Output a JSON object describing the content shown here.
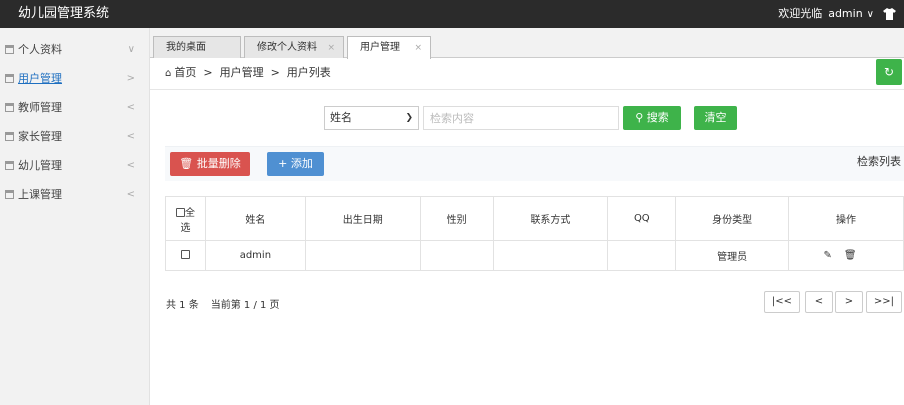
{
  "app": {
    "title": "幼儿园管理系统",
    "welcome": "欢迎光临",
    "username": "admin",
    "caret": "∨"
  },
  "sidebar": {
    "items": [
      {
        "label": "个人资料",
        "arrow": "∨"
      },
      {
        "label": "用户管理",
        "arrow": ">"
      },
      {
        "label": "教师管理",
        "arrow": "<"
      },
      {
        "label": "家长管理",
        "arrow": "<"
      },
      {
        "label": "幼儿管理",
        "arrow": "<"
      },
      {
        "label": "上课管理",
        "arrow": "<"
      }
    ]
  },
  "tabs": [
    {
      "label": "我的桌面"
    },
    {
      "label": "修改个人资料",
      "close": "×"
    },
    {
      "label": "用户管理",
      "close": "×"
    }
  ],
  "breadcrumb": {
    "home": "首页",
    "sep": ">",
    "level1": "用户管理",
    "level2": "用户列表"
  },
  "search": {
    "field": "姓名",
    "placeholder": "检索内容",
    "search_label": "搜索",
    "clear_label": "清空"
  },
  "actions": {
    "batch_delete": "批量删除",
    "add": "添加",
    "right_text": "检索列表"
  },
  "table": {
    "select_all_line1": "全",
    "select_all_line2": "选",
    "headers": [
      "姓名",
      "出生日期",
      "性别",
      "联系方式",
      "QQ",
      "身份类型",
      "操作"
    ],
    "rows": [
      {
        "name": "admin",
        "birth": "",
        "gender": "",
        "contact": "",
        "qq": "",
        "role": "管理员"
      }
    ]
  },
  "footer": {
    "total": "共 1 条",
    "page": "当前第 1 / 1 页"
  },
  "pager": {
    "first": "|<<",
    "prev": "<",
    "next": ">",
    "last": ">>|"
  },
  "colors": {
    "topbar": "#2b2b2b",
    "green": "#3eb34a",
    "red": "#d9534f",
    "blue": "#4f90d2",
    "link": "#1e6fc0"
  }
}
